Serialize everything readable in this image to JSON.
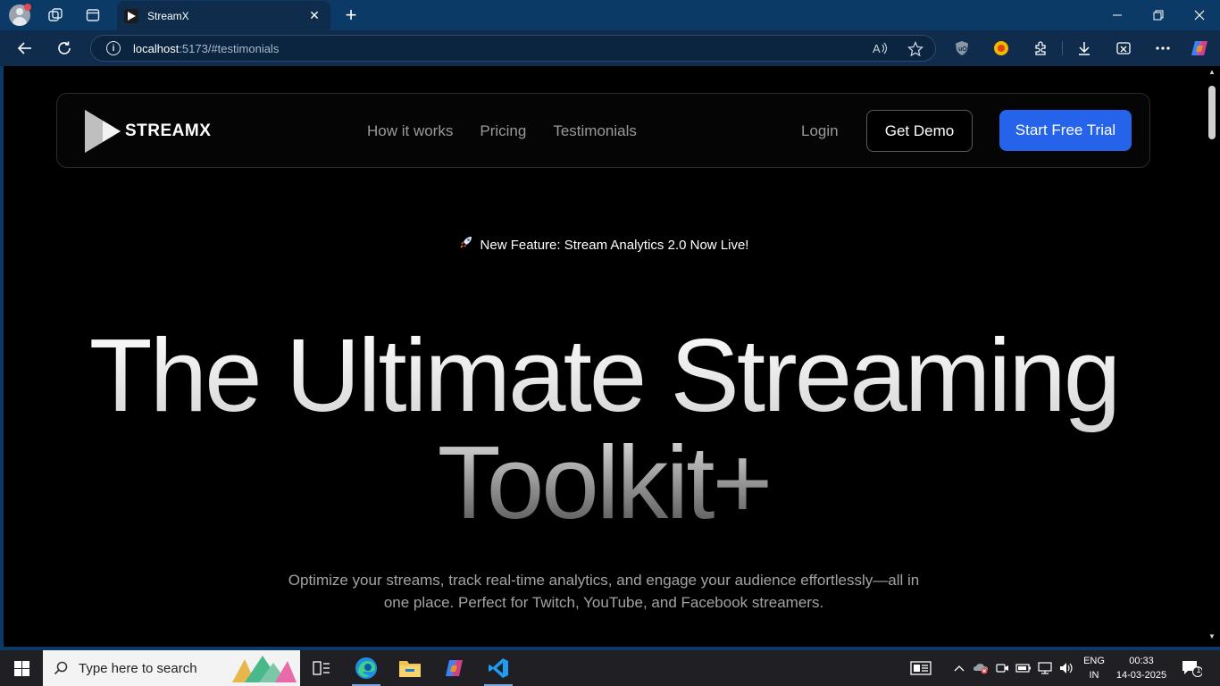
{
  "browser": {
    "tab_title": "StreamX",
    "url_host": "localhost",
    "url_path": ":5173/#testimonials",
    "icons": [
      "profile-icon",
      "workspaces-icon",
      "tab-actions-icon",
      "close-tab-icon",
      "new-tab-icon",
      "back-icon",
      "refresh-icon",
      "site-info-icon",
      "read-aloud-icon",
      "favorite-icon",
      "ublock-icon",
      "extension-icon",
      "extensions-icon",
      "downloads-icon",
      "screenshot-icon",
      "more-icon",
      "copilot-icon"
    ]
  },
  "page": {
    "brand": "STREAMX",
    "nav_links": [
      "How it works",
      "Pricing",
      "Testimonials"
    ],
    "login": "Login",
    "demo_button": "Get Demo",
    "trial_button": "Start Free Trial",
    "announcement": "New Feature: Stream Analytics 2.0 Now Live!",
    "hero_line1": "The Ultimate Streaming",
    "hero_line2": "Toolkit+",
    "subtitle": "Optimize your streams, track real-time analytics, and engage your audience effortlessly—all in one place. Perfect for Twitch, YouTube, and Facebook streamers.",
    "accent_color": "#2563eb"
  },
  "taskbar": {
    "search_placeholder": "Type here to search",
    "lang_line1": "ENG",
    "lang_line2": "IN",
    "time": "00:33",
    "date": "14-03-2025",
    "notification_count": "1"
  }
}
